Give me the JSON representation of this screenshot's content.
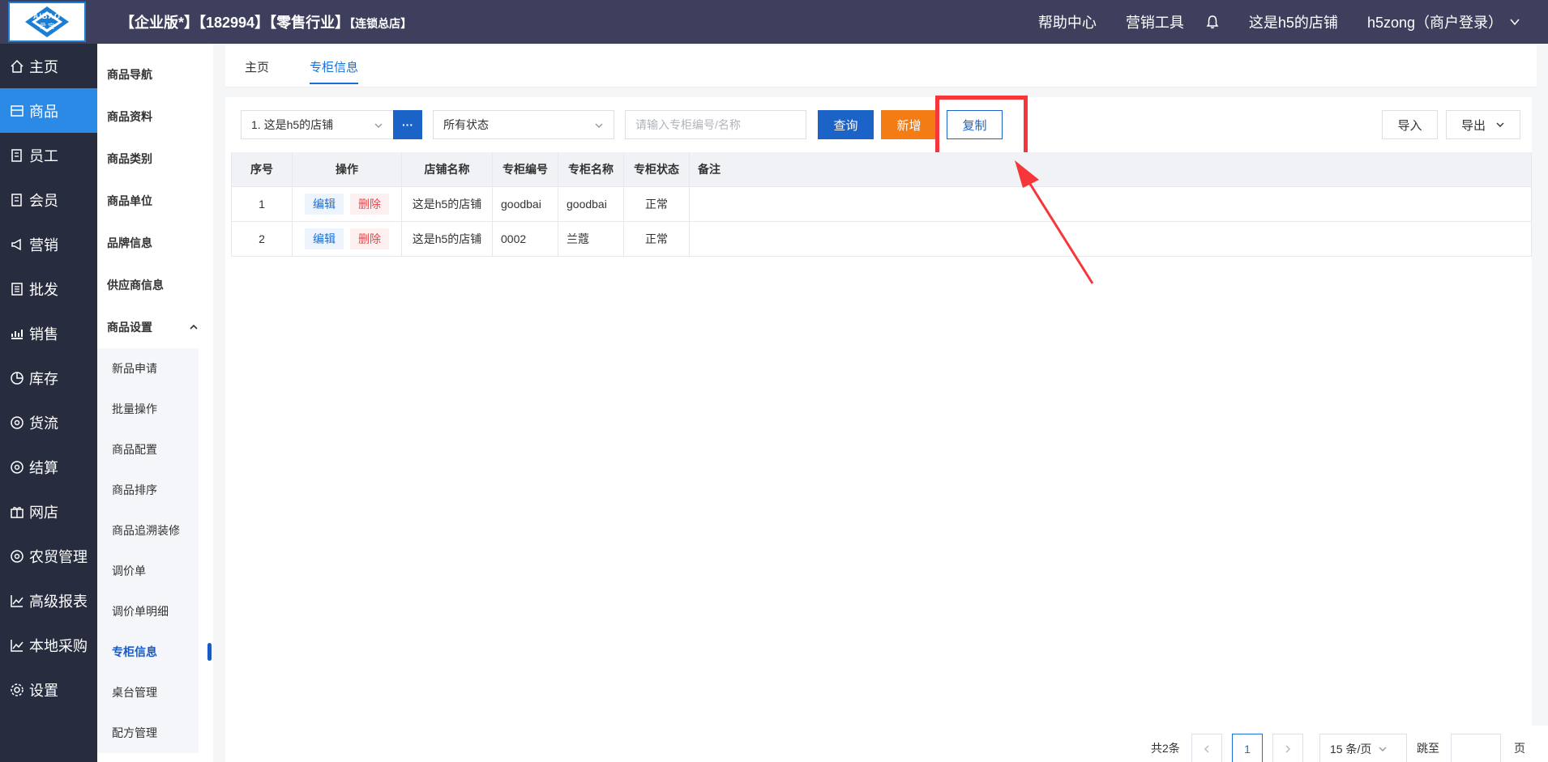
{
  "header": {
    "logo_brand": "AIBAO",
    "logo_sub": "爱 宝",
    "title": "【企业版*】【182994】【零售行业】",
    "title_small": "【连锁总店】",
    "help": "帮助中心",
    "marketing_tools": "营销工具",
    "store_name": "这是h5的店铺",
    "user": "h5zong（商户登录）"
  },
  "sidebar": {
    "items": [
      {
        "label": "主页",
        "icon": "home-icon"
      },
      {
        "label": "商品",
        "icon": "goods-icon"
      },
      {
        "label": "员工",
        "icon": "staff-icon"
      },
      {
        "label": "会员",
        "icon": "member-icon"
      },
      {
        "label": "营销",
        "icon": "marketing-icon"
      },
      {
        "label": "批发",
        "icon": "wholesale-icon"
      },
      {
        "label": "销售",
        "icon": "sales-icon"
      },
      {
        "label": "库存",
        "icon": "inventory-icon"
      },
      {
        "label": "货流",
        "icon": "logistics-icon"
      },
      {
        "label": "结算",
        "icon": "settlement-icon"
      },
      {
        "label": "网店",
        "icon": "gift-icon"
      },
      {
        "label": "农贸管理",
        "icon": "farm-icon"
      },
      {
        "label": "高级报表",
        "icon": "report-icon"
      },
      {
        "label": "本地采购",
        "icon": "purchase-icon"
      },
      {
        "label": "设置",
        "icon": "gear-icon"
      }
    ]
  },
  "subbar": {
    "items": [
      "商品导航",
      "商品资料",
      "商品类别",
      "商品单位",
      "品牌信息",
      "供应商信息"
    ],
    "group": "商品设置",
    "children": [
      "新品申请",
      "批量操作",
      "商品配置",
      "商品排序",
      "商品追溯装修",
      "调价单",
      "调价单明细",
      "专柜信息",
      "桌台管理",
      "配方管理"
    ]
  },
  "tabs": [
    "主页",
    "专柜信息"
  ],
  "toolbar": {
    "store_select": "1. 这是h5的店铺",
    "dots": "···",
    "status_select": "所有状态",
    "search_placeholder": "请输入专柜编号/名称",
    "query": "查询",
    "new": "新增",
    "copy": "复制",
    "import": "导入",
    "export": "导出"
  },
  "table": {
    "headers": [
      "序号",
      "操作",
      "店铺名称",
      "专柜编号",
      "专柜名称",
      "专柜状态",
      "备注"
    ],
    "edit": "编辑",
    "delete": "删除",
    "rows": [
      {
        "no": "1",
        "store": "这是h5的店铺",
        "code": "goodbai",
        "name": "goodbai",
        "status": "正常",
        "note": ""
      },
      {
        "no": "2",
        "store": "这是h5的店铺",
        "code": "0002",
        "name": "兰蔻",
        "status": "正常",
        "note": ""
      }
    ]
  },
  "pager": {
    "total": "共2条",
    "current": "1",
    "size": "15 条/页",
    "jump": "跳至",
    "page": "页"
  },
  "colors": {
    "header_bg": "#3d3f5c",
    "sidebar_bg": "#282c3f",
    "active_blue": "#2b8ae6",
    "primary": "#1b63c7",
    "orange": "#f47c15",
    "highlight_red": "#f5363a"
  }
}
